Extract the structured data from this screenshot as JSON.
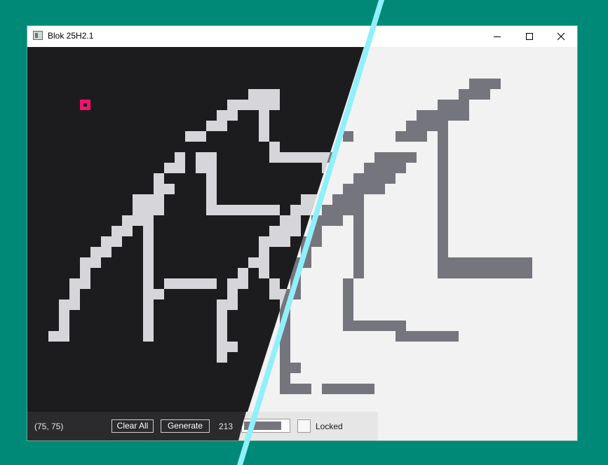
{
  "window": {
    "title": "Blok 25H2.1",
    "minimize_icon": "minimize-icon",
    "maximize_icon": "maximize-icon",
    "close_icon": "close-icon"
  },
  "canvas": {
    "dark_background": "#1c1c1e",
    "light_background": "#f2f2f2",
    "dark_block_color": "#d6d6da",
    "light_block_color": "#75757d",
    "cursor_color": "#f2136b",
    "accent_line_color": "#8ff0fa"
  },
  "toolbar": {
    "coords": "(75, 75)",
    "clear_label": "Clear All",
    "generate_label": "Generate",
    "count": "213",
    "progress_fraction": 0.85,
    "locked_label": "Locked",
    "locked_checked": false
  }
}
